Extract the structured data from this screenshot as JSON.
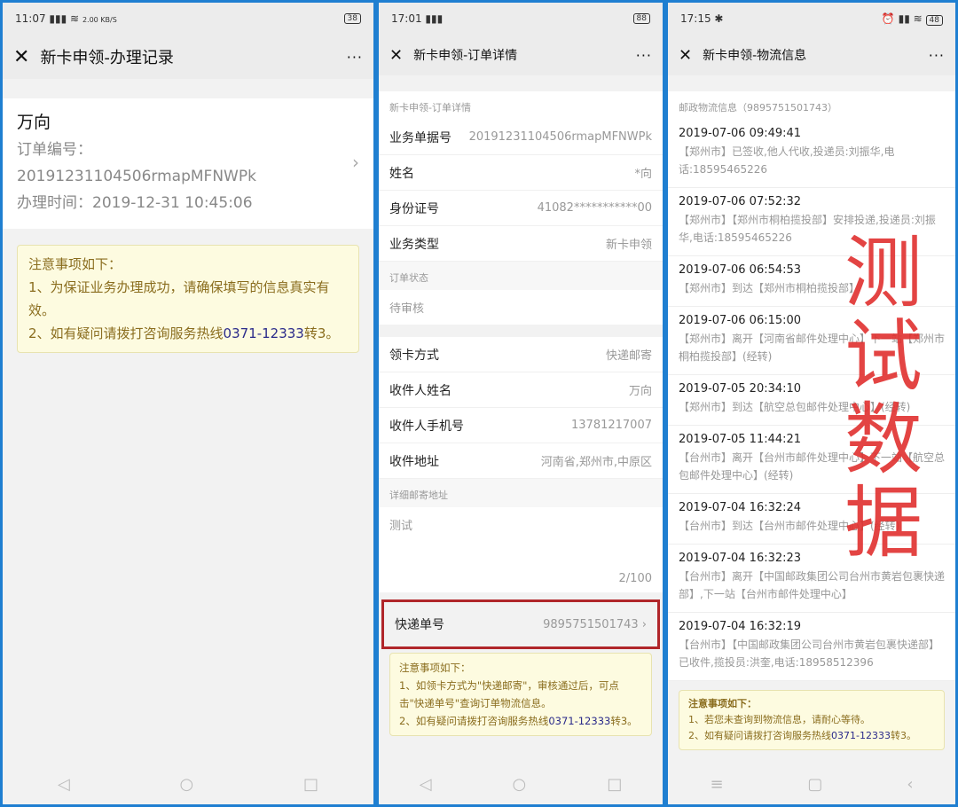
{
  "panel1": {
    "status": {
      "time": "11:07",
      "net": "2.00 KB/S",
      "battery": "38"
    },
    "title": "新卡申领-办理记录",
    "record": {
      "name": "万向",
      "order_label": "订单编号：",
      "order_no": "20191231104506rmapMFNWPk",
      "time": "办理时间：2019-12-31 10:45:06"
    },
    "notice": {
      "title": "注意事项如下：",
      "line1": "1、为保证业务办理成功，请确保填写的信息真实有效。",
      "line2_pre": "2、如有疑问请拨打咨询服务热线",
      "hotline": "0371-12333",
      "line2_post": "转3。"
    }
  },
  "panel2": {
    "status": {
      "time": "17:01",
      "battery": "88"
    },
    "title": "新卡申领-订单详情",
    "section_header": "新卡申领-订单详情",
    "rows": [
      {
        "label": "业务单据号",
        "value": "20191231104506rmapMFNWPk"
      },
      {
        "label": "姓名",
        "value": "*向"
      },
      {
        "label": "身份证号",
        "value": "41082***********00"
      },
      {
        "label": "业务类型",
        "value": "新卡申领"
      }
    ],
    "status_label": "订单状态",
    "status_value": "待审核",
    "rows2": [
      {
        "label": "领卡方式",
        "value": "快递邮寄"
      },
      {
        "label": "收件人姓名",
        "value": "万向"
      },
      {
        "label": "收件人手机号",
        "value": "13781217007"
      },
      {
        "label": "收件地址",
        "value": "河南省,郑州市,中原区"
      }
    ],
    "address_label": "详细邮寄地址",
    "address_value": "测试",
    "counter": "2/100",
    "tracking": {
      "label": "快递单号",
      "value": "9895751501743"
    },
    "notice": {
      "title": "注意事项如下：",
      "line1": "1、如领卡方式为\"快递邮寄\"，审核通过后，可点击\"快递单号\"查询订单物流信息。",
      "line2_pre": "2、如有疑问请拨打咨询服务热线",
      "hotline": "0371-12333",
      "line2_post": "转3。"
    }
  },
  "panel3": {
    "status": {
      "time": "17:15",
      "battery": "48"
    },
    "title": "新卡申领-物流信息",
    "header": "邮政物流信息（9895751501743）",
    "entries": [
      {
        "time": "2019-07-06 09:49:41",
        "desc": "【郑州市】已签收,他人代收,投递员:刘振华,电话:18595465226"
      },
      {
        "time": "2019-07-06 07:52:32",
        "desc": "【郑州市】【郑州市桐柏揽投部】安排投递,投递员:刘振华,电话:18595465226"
      },
      {
        "time": "2019-07-06 06:54:53",
        "desc": "【郑州市】到达【郑州市桐柏揽投部】"
      },
      {
        "time": "2019-07-06 06:15:00",
        "desc": "【郑州市】离开【河南省邮件处理中心】下一站【郑州市桐柏揽投部】(经转)"
      },
      {
        "time": "2019-07-05 20:34:10",
        "desc": "【郑州市】到达【航空总包邮件处理中心】(经转)"
      },
      {
        "time": "2019-07-05 11:44:21",
        "desc": "【台州市】离开【台州市邮件处理中心】下一站【航空总包邮件处理中心】(经转)"
      },
      {
        "time": "2019-07-04 16:32:24",
        "desc": "【台州市】到达【台州市邮件处理中心】(经转)"
      },
      {
        "time": "2019-07-04 16:32:23",
        "desc": "【台州市】离开【中国邮政集团公司台州市黄岩包裹快递部】,下一站【台州市邮件处理中心】"
      },
      {
        "time": "2019-07-04 16:32:19",
        "desc": "【台州市】【中国邮政集团公司台州市黄岩包裹快递部】已收件,揽投员:洪奎,电话:18958512396"
      }
    ],
    "notice": {
      "title": "注意事项如下：",
      "line1": "1、若您未查询到物流信息，请耐心等待。",
      "line2_pre": "2、如有疑问请拨打咨询服务热线",
      "hotline": "0371-12333",
      "line2_post": "转3。"
    },
    "watermark": "测试数据"
  },
  "colors": {
    "border": "#1f7fd1",
    "highlight": "#b0262a",
    "watermark": "#e0302f",
    "notice_bg": "#fdfbe0"
  }
}
